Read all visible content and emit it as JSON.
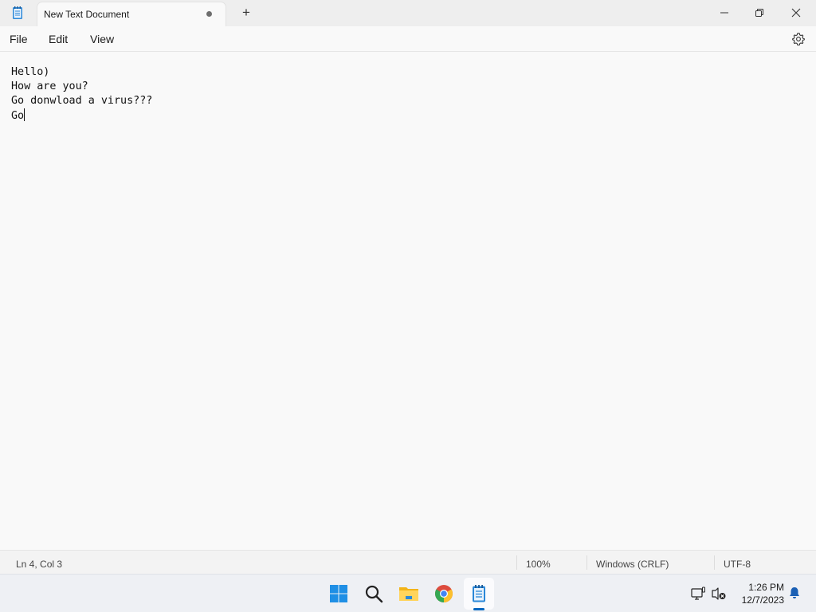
{
  "window": {
    "tab_title": "New Text Document",
    "new_tab_label": "+"
  },
  "menu": {
    "file": "File",
    "edit": "Edit",
    "view": "View"
  },
  "editor": {
    "lines": [
      "Hello)",
      "How are you?",
      "Go donwload a virus???",
      "Go"
    ]
  },
  "status": {
    "position": "Ln 4, Col 3",
    "zoom": "100%",
    "line_ending": "Windows (CRLF)",
    "encoding": "UTF-8"
  },
  "taskbar": {
    "apps": [
      "start-icon",
      "search-icon",
      "file-explorer-icon",
      "chrome-icon",
      "notepad-icon"
    ],
    "time": "1:26 PM",
    "date": "12/7/2023"
  },
  "colors": {
    "accent": "#0067c0",
    "background": "#f9f9f9"
  }
}
